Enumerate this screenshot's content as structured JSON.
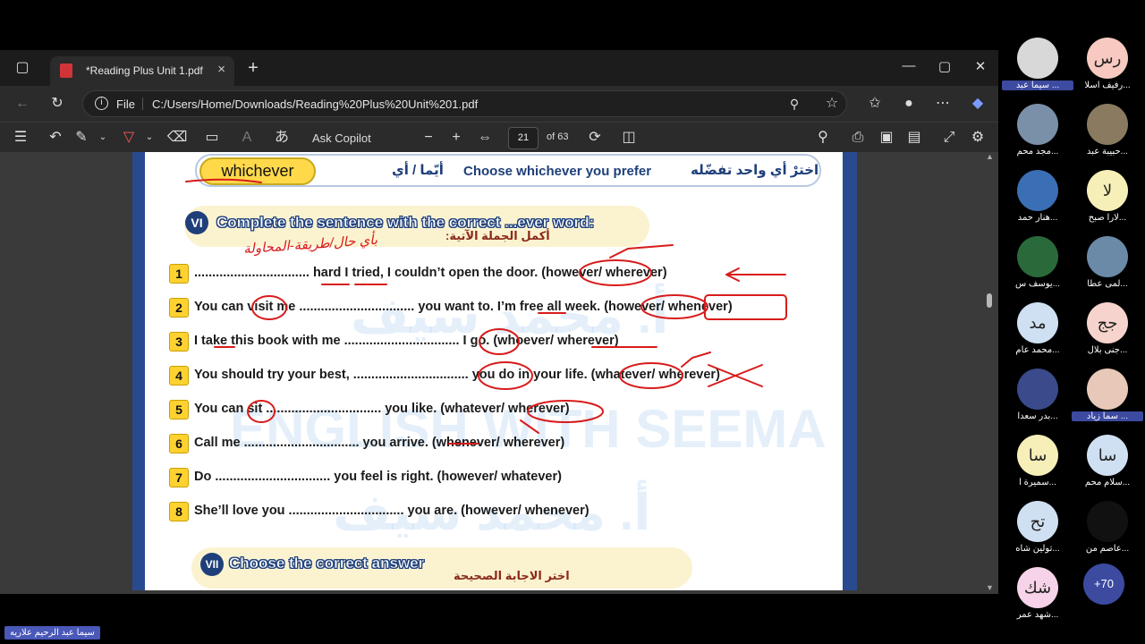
{
  "browser": {
    "tab_title": "*Reading Plus Unit 1.pdf",
    "url_prefix": "File",
    "url": "C:/Users/Home/Downloads/Reading%20Plus%20Unit%201.pdf"
  },
  "pdf_toolbar": {
    "ask_copilot": "Ask Copilot",
    "page_current": "21",
    "page_total": "of 63"
  },
  "document": {
    "pill_word": "whichever",
    "banner_arabic_1": "أيّما / أي",
    "banner_english": "Choose whichever you prefer",
    "banner_arabic_2": "اخترْ أي واحد تفضّله",
    "section6_num": "VI",
    "section6_title": "Complete the sentence with the correct ...ever word:",
    "section6_arabic": "أكمل الجملة الآتية:",
    "handwritten_arabic": "بأي حال/طريقة-المحاولة",
    "sentences": [
      {
        "num": "1",
        "text": "................................ hard I tried, I couldn’t open the door. (however/ wherever)"
      },
      {
        "num": "2",
        "text": "You can visit me ................................ you want to. I’m free all week. (however/ whenever)"
      },
      {
        "num": "3",
        "text": "I take this book with me ................................ I go. (whoever/ wherever)"
      },
      {
        "num": "4",
        "text": "You should try your best, ................................ you do in your life. (whatever/ wherever)"
      },
      {
        "num": "5",
        "text": "You can sit ................................ you like. (whatever/ wherever)"
      },
      {
        "num": "6",
        "text": "Call me ................................ you arrive. (whenever/ wherever)"
      },
      {
        "num": "7",
        "text": "Do ................................ you feel is right. (however/ whatever)"
      },
      {
        "num": "8",
        "text": "She’ll love you ................................ you are. (however/ whenever)"
      }
    ],
    "section7_num": "VII",
    "section7_title": "Choose the correct answer",
    "section7_arabic": "اختر الاجابة الصحيحة",
    "watermark_1": "أ. محمد سيف",
    "watermark_2": "ENGLISH WITH SEEMA"
  },
  "participants": [
    {
      "initials": "",
      "name": "سيما عبد ...",
      "color": "#d8d8d8",
      "highlight": true
    },
    {
      "initials": "رس",
      "name": "رفيف اسلا...",
      "color": "#f7c9c0",
      "highlight": false
    },
    {
      "initials": "",
      "name": "مجد محم...",
      "color": "#7a8fa8",
      "highlight": false
    },
    {
      "initials": "",
      "name": "حبيبة عبد...",
      "color": "#8a7a60",
      "highlight": false
    },
    {
      "initials": "",
      "name": "هنار حمد...",
      "color": "#3b6fb5",
      "highlight": false
    },
    {
      "initials": "لا",
      "name": "لارا صبح...",
      "color": "#f7efb8",
      "highlight": false
    },
    {
      "initials": "",
      "name": "يوسف س...",
      "color": "#2a6a3a",
      "highlight": false
    },
    {
      "initials": "",
      "name": "لمى عطا...",
      "color": "#6a8aa8",
      "highlight": false
    },
    {
      "initials": "مد",
      "name": "محمد عام...",
      "color": "#cfe0f2",
      "highlight": false
    },
    {
      "initials": "جج",
      "name": "جنى بلال...",
      "color": "#f6d3cc",
      "highlight": false
    },
    {
      "initials": "",
      "name": "بدر سعدا...",
      "color": "#3a4a8a",
      "highlight": false
    },
    {
      "initials": "",
      "name": "سما زياد ...",
      "color": "#e8c8b8",
      "highlight": true
    },
    {
      "initials": "سا",
      "name": "سميرة أ...",
      "color": "#f7efb8",
      "highlight": false
    },
    {
      "initials": "سا",
      "name": "سلام محم...",
      "color": "#cfe0f2",
      "highlight": false
    },
    {
      "initials": "تح",
      "name": "تولين شاه...",
      "color": "#cfe0f2",
      "highlight": false
    },
    {
      "initials": "",
      "name": "عاصم من...",
      "color": "#111111",
      "highlight": false
    },
    {
      "initials": "شك",
      "name": "شهد عمر...",
      "color": "#f6d3e8",
      "highlight": false
    }
  ],
  "more_count": "+70",
  "self_label": "سيما عبد الرحيم علاريه",
  "colors": {
    "accent": "#3c4aa0",
    "ink": "#d81b1b",
    "pill": "#ffd94a"
  }
}
